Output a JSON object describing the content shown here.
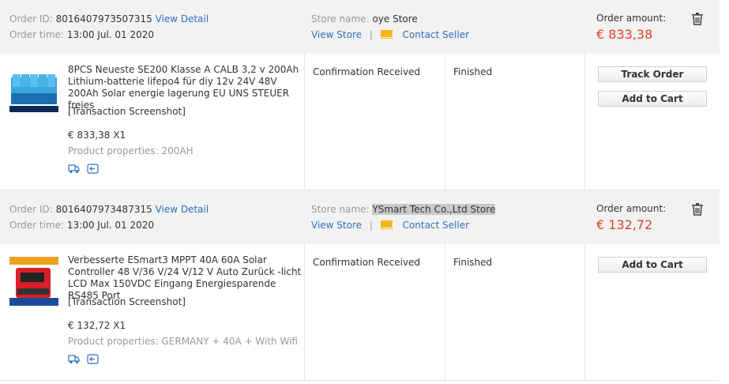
{
  "orders": [
    {
      "id_label": "Order ID:",
      "id": "8016407973507315",
      "view_detail": "View Detail",
      "time_label": "Order time:",
      "time": "13:00 Jul. 01 2020",
      "store_label": "Store name:",
      "store": "oye Store",
      "view_store": "View Store",
      "separator": "|",
      "contact_seller": "Contact Seller",
      "amount_label": "Order amount:",
      "amount": "€ 833,38",
      "product_title": "8PCS Neueste SE200 Klasse A CALB 3,2 v 200Ah Lithium-batterie lifepo4 für diy 12v 24V 48V 200Ah Solar energie lagerung EU UNS STEUER freies",
      "snapshot": "[Transaction Screenshot]",
      "price_qty": "€ 833,38 X1",
      "properties": "Product properties: 200AH",
      "status": "Confirmation Received",
      "state": "Finished",
      "buttons": [
        "Track Order",
        "Add to Cart"
      ]
    },
    {
      "id_label": "Order ID:",
      "id": "8016407973487315",
      "view_detail": "View Detail",
      "time_label": "Order time:",
      "time": "13:00 Jul. 01 2020",
      "store_label": "Store name:",
      "store": "YSmart Tech Co.,Ltd Store",
      "view_store": "View Store",
      "separator": "|",
      "contact_seller": "Contact Seller",
      "amount_label": "Order amount:",
      "amount": "€ 132,72",
      "product_title": "Verbesserte ESmart3 MPPT 40A 60A Solar Controller 48 V/36 V/24 V/12 V Auto Zurück -licht LCD Max 150VDC Eingang Energiesparende RS485 Port",
      "snapshot": "[Transaction Screenshot]",
      "price_qty": "€ 132,72 X1",
      "properties": "Product properties: GERMANY + 40A + With Wifi",
      "status": "Confirmation Received",
      "state": "Finished",
      "buttons": [
        "Add to Cart"
      ]
    }
  ],
  "colors": {
    "link": "#2f6fbd",
    "price": "#e5402a",
    "header_bg": "#f2f2f2",
    "mail_icon": "#f2b81d"
  },
  "icons": [
    "trash-icon",
    "mail-icon",
    "shipping-icon",
    "return-icon"
  ]
}
